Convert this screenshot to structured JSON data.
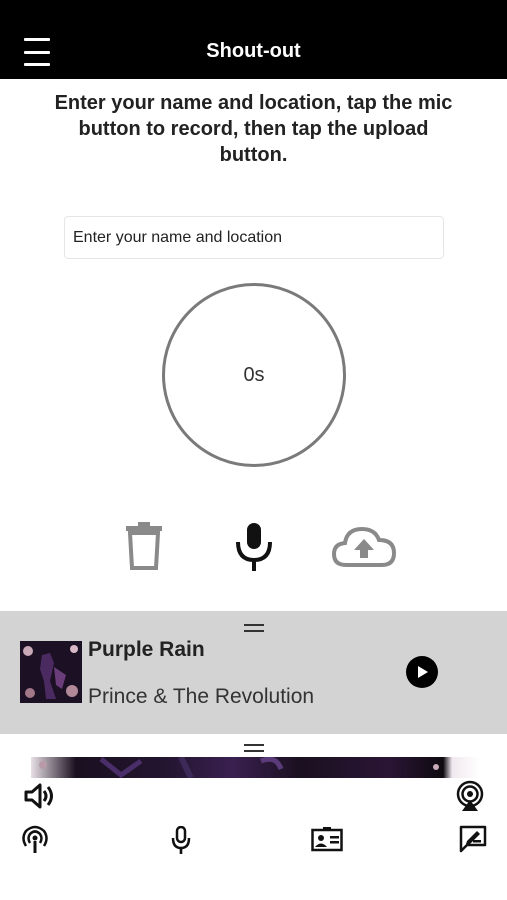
{
  "header": {
    "title": "Shout-out"
  },
  "instructions": "Enter your name and location, tap the mic button to record, then tap the upload button.",
  "name_input": {
    "placeholder": "Enter your name and location",
    "value": ""
  },
  "timer": {
    "display": "0s"
  },
  "controls": {
    "delete_icon": "trash-icon",
    "record_icon": "mic-icon",
    "upload_icon": "cloud-upload-icon"
  },
  "now_playing": {
    "title": "Purple Rain",
    "artist": "Prince & The Revolution"
  },
  "bottom_bar": {
    "top_row": [
      "volume-icon",
      "airplay-icon"
    ],
    "bottom_row": [
      "podcast-icon",
      "mic-icon",
      "contact-card-icon",
      "message-edit-icon"
    ]
  },
  "colors": {
    "header_bg": "#000000",
    "player_bg": "#d3d3d3",
    "icon_gray": "#8a8a8a",
    "timer_ring": "#7a7a7a"
  }
}
